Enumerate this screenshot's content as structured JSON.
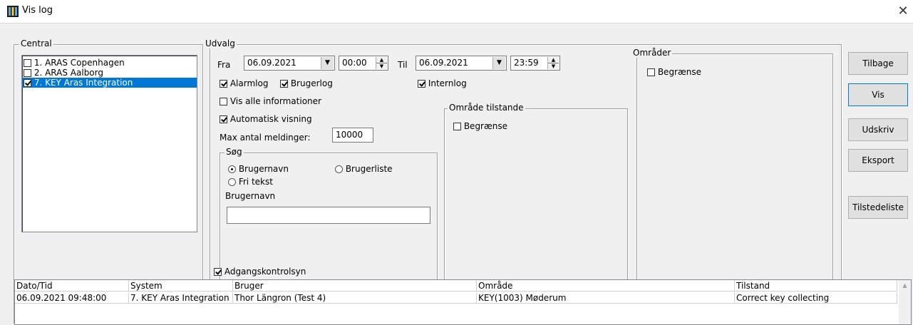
{
  "window": {
    "title": "Vis log",
    "close": "✕"
  },
  "central": {
    "label": "Central",
    "items": [
      {
        "label": "1. ARAS Copenhagen",
        "checked": false,
        "selected": false
      },
      {
        "label": "2. ARAS Aalborg",
        "checked": false,
        "selected": false
      },
      {
        "label": "7. KEY Aras Integration",
        "checked": true,
        "selected": true
      }
    ]
  },
  "udvalg": {
    "label": "Udvalg",
    "fra_label": "Fra",
    "fra_date": "06.09.2021",
    "fra_time": "00:00",
    "til_label": "Til",
    "til_date": "06.09.2021",
    "til_time": "23:59",
    "alarmlog": "Alarmlog",
    "brugerlog": "Brugerlog",
    "internlog": "Internlog",
    "vis_alle": "Vis alle informationer",
    "automatisk": "Automatisk visning",
    "max_label": "Max antal meldinger:",
    "max_value": "10000",
    "soeg": {
      "label": "Søg",
      "brugernavn_radio": "Brugernavn",
      "brugerliste_radio": "Brugerliste",
      "fri_tekst_radio": "Fri tekst",
      "field_label": "Brugernavn",
      "field_value": ""
    },
    "omraade_tilstande": {
      "label": "Område tilstande",
      "begraense": "Begrænse"
    }
  },
  "omraader": {
    "label": "Områder",
    "begraense": "Begrænse"
  },
  "buttons": {
    "tilbage": "Tilbage",
    "vis": "Vis",
    "udskriv": "Udskriv",
    "eksport": "Eksport",
    "tilstedeliste": "Tilstedeliste"
  },
  "adgangskontrolsyn": "Adgangskontrolsyn",
  "table": {
    "headers": [
      "Dato/Tid",
      "System",
      "Bruger",
      "Område",
      "Tilstand"
    ],
    "rows": [
      [
        "06.09.2021 09:48:00",
        "7. KEY Aras Integration",
        "Thor Längron (Test 4)",
        "KEY(1003)  Møderum",
        "Correct key collecting"
      ]
    ]
  },
  "colors": {
    "selection": "#0078d7",
    "window_bg": "#f0f0f0"
  }
}
